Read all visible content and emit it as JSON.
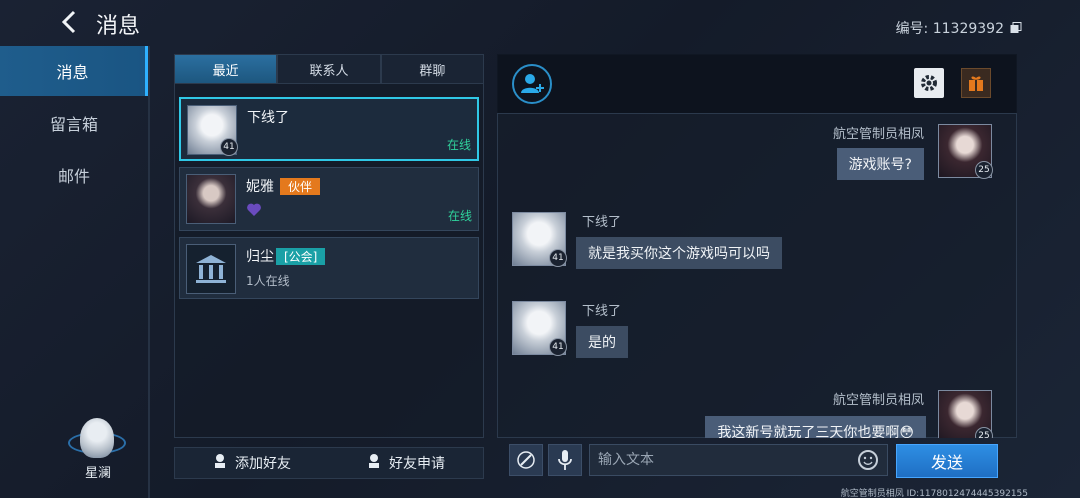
{
  "header": {
    "title": "消息",
    "id_label": "编号: 11329392"
  },
  "nav": {
    "items": [
      {
        "label": "消息"
      },
      {
        "label": "留言箱"
      },
      {
        "label": "邮件"
      }
    ],
    "self_name": "星澜"
  },
  "tabs": [
    {
      "label": "最近"
    },
    {
      "label": "联系人"
    },
    {
      "label": "群聊"
    }
  ],
  "contacts": [
    {
      "name": "下线了",
      "level": "41",
      "status": "在线"
    },
    {
      "name": "妮雅",
      "badge": "伙伴",
      "status": "在线"
    },
    {
      "name": "归尘",
      "badge": "[公会]",
      "sub": "1人在线"
    }
  ],
  "bottom_buttons": {
    "add_friend": "添加好友",
    "friend_requests": "好友申请"
  },
  "chat": {
    "messages": [
      {
        "sender": "航空管制员相凤",
        "text": "游戏账号?",
        "level": "25",
        "mine": true
      },
      {
        "sender": "下线了",
        "text": "就是我买你这个游戏吗可以吗",
        "level": "41",
        "mine": false
      },
      {
        "sender": "下线了",
        "text": "是的",
        "level": "41",
        "mine": false
      },
      {
        "sender": "航空管制员相凤",
        "text": "我这新号就玩了三天你也要啊😳",
        "level": "25",
        "mine": true
      }
    ]
  },
  "input": {
    "placeholder": "输入文本",
    "send_label": "发送"
  },
  "footer": {
    "id_text": "航空管制员相凤  ID:1178012474445392155"
  },
  "colors": {
    "accent": "#2fb1ff",
    "online": "#2fd29c",
    "partner": "#e4791d",
    "guild": "#1aa0a6"
  }
}
